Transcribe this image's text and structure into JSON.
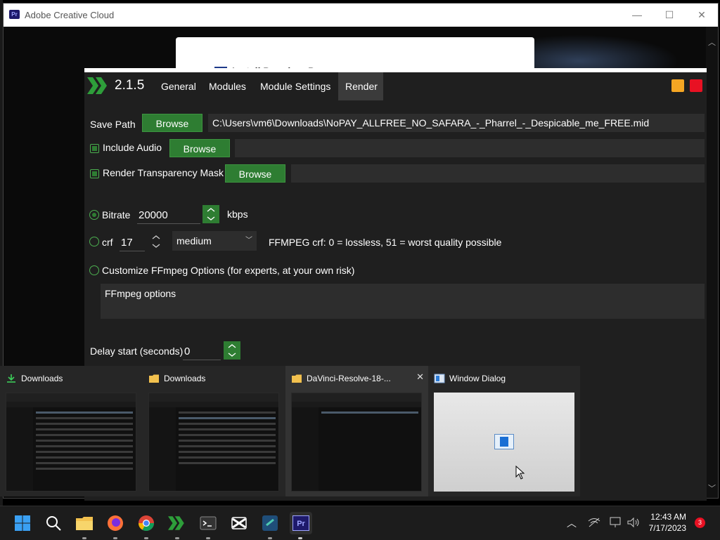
{
  "adobe_window": {
    "title": "Adobe Creative Cloud",
    "badge": "Pr",
    "card_title": "Install Premiere Pro"
  },
  "app": {
    "version": "2.1.5",
    "tabs": [
      {
        "label": "General"
      },
      {
        "label": "Modules"
      },
      {
        "label": "Module Settings"
      },
      {
        "label": "Render",
        "active": true
      }
    ],
    "save_path": {
      "label": "Save Path",
      "button": "Browse",
      "value": "C:\\Users\\vm6\\Downloads\\NoPAY_ALLFREE_NO_SAFARA_-_Pharrel_-_Despicable_me_FREE.mid"
    },
    "include_audio": {
      "label": "Include Audio",
      "checked": true,
      "button": "Browse",
      "value": ""
    },
    "transparency_mask": {
      "label": "Render Transparency Mask",
      "checked": true,
      "button": "Browse",
      "value": ""
    },
    "bitrate": {
      "label": "Bitrate",
      "selected": true,
      "value": "20000",
      "unit": "kbps"
    },
    "crf": {
      "label": "crf",
      "selected": false,
      "value": "17",
      "preset": "medium",
      "hint": "FFMPEG crf: 0 = lossless, 51 = worst quality possible"
    },
    "custom_ffmpeg": {
      "label": "Customize FFmpeg Options (for experts, at your own risk)",
      "selected": false,
      "placeholder": "FFmpeg options"
    },
    "delay_start": {
      "label": "Delay start (seconds)",
      "value": "0"
    },
    "colors": {
      "accent": "#2e7d32",
      "minimize_square": "#f5a623",
      "close_square": "#e81123",
      "background": "#1f1f1f"
    }
  },
  "task_switcher": [
    {
      "title": "Downloads",
      "icon": "download-arrow-icon"
    },
    {
      "title": "Downloads",
      "icon": "folder-icon"
    },
    {
      "title": "DaVinci-Resolve-18-...",
      "icon": "folder-icon",
      "close": "✕"
    },
    {
      "title": "Window Dialog",
      "icon": "window-dialog-icon"
    }
  ],
  "taskbar": {
    "apps": [
      "windows-start-icon",
      "search-icon",
      "file-explorer-icon",
      "firefox-icon",
      "chrome-icon",
      "green-chevron-app-icon",
      "terminal-icon",
      "capcut-icon",
      "ide-icon",
      "premiere-pro-icon"
    ],
    "time": "12:43 AM",
    "date": "7/17/2023",
    "notifications": "3",
    "premiere_badge": "Pr"
  }
}
